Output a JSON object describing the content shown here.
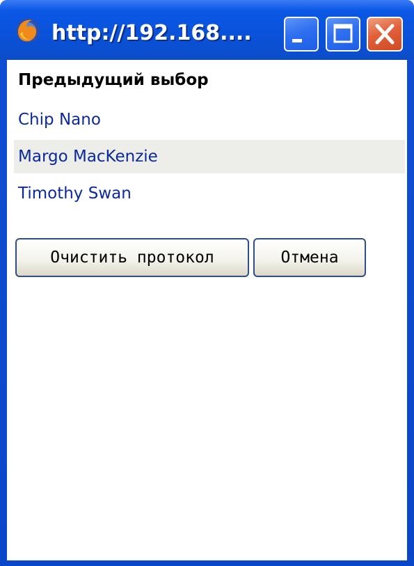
{
  "window": {
    "title": "http://192.168....",
    "app_icon": "firefox-icon",
    "controls": {
      "minimize_icon": "minimize-icon",
      "maximize_icon": "maximize-icon",
      "close_icon": "close-icon"
    }
  },
  "panel": {
    "heading": "Предыдущий выбор",
    "items": [
      {
        "label": "Chip Nano"
      },
      {
        "label": "Margo MacKenzie"
      },
      {
        "label": "Timothy Swan"
      }
    ],
    "clear_label": "Очистить протокол",
    "cancel_label": "Отмена"
  },
  "colors": {
    "titlebar": "#0b52da",
    "link": "#0b2a9a",
    "highlight_row": "#ededea",
    "close_button": "#e0613a"
  }
}
